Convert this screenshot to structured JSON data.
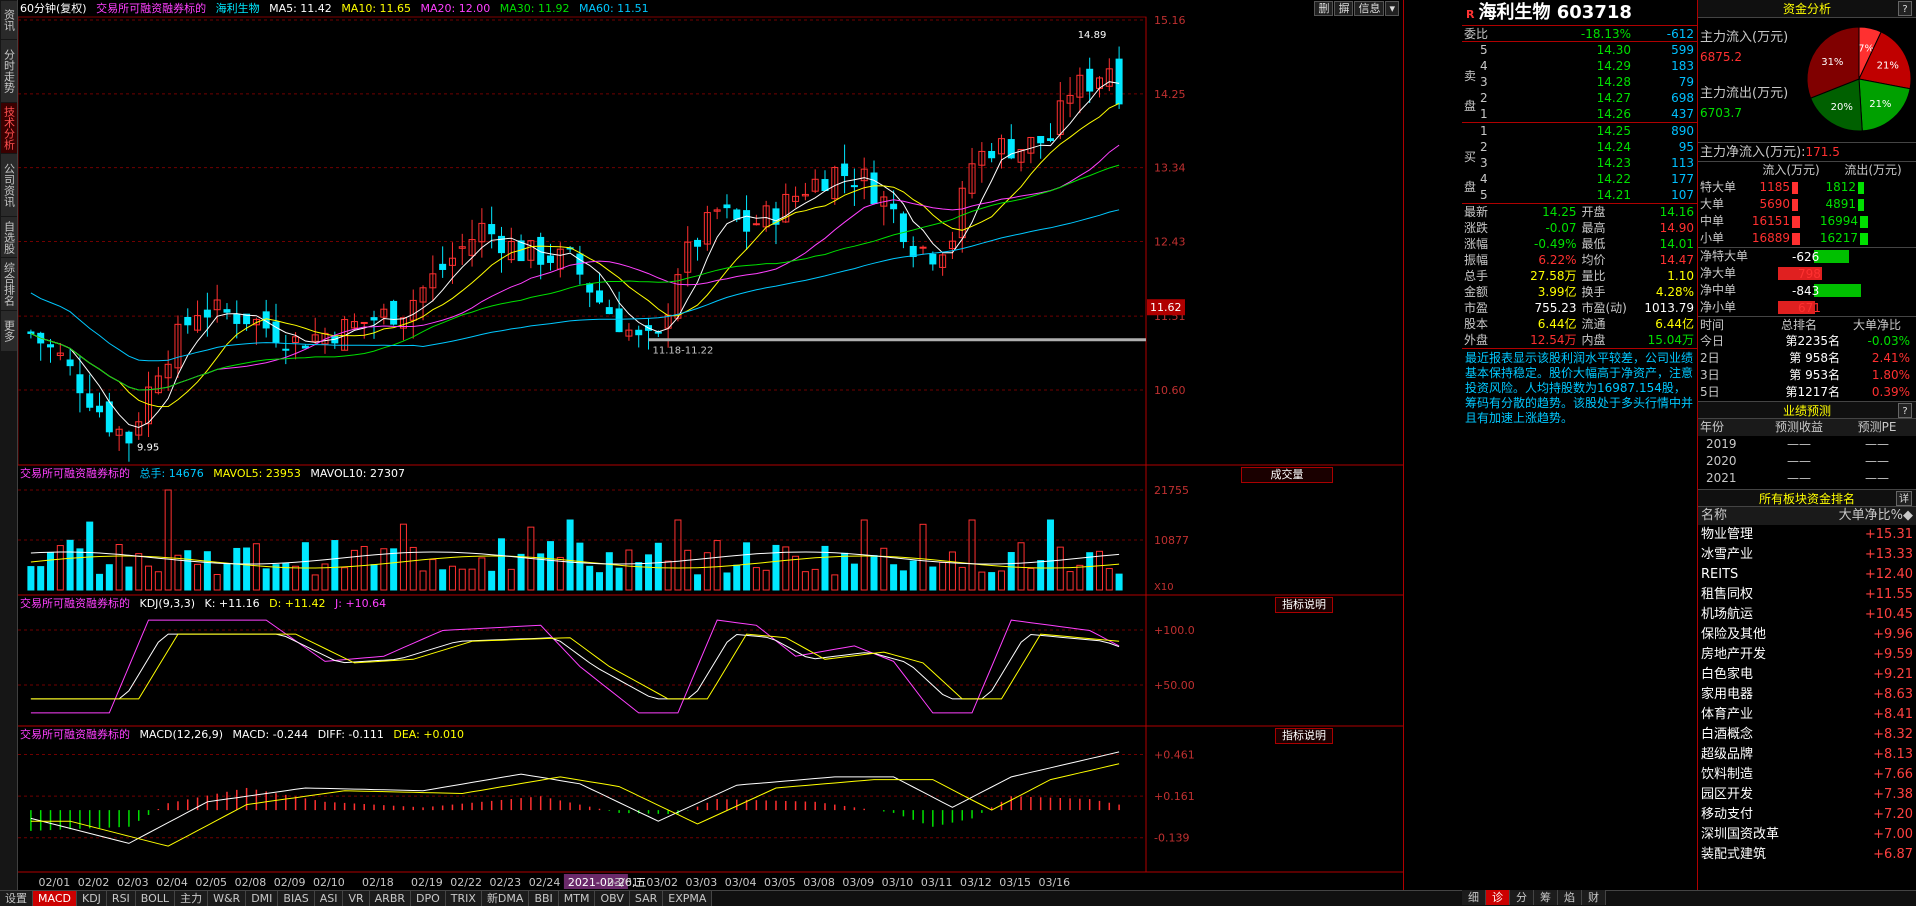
{
  "chart_header": {
    "period": "60分钟(复权)",
    "tag": "交易所可融资融券标的",
    "stock": "海利生物",
    "ma5": "MA5: 11.42",
    "ma10": "MA10: 11.65",
    "ma20": "MA20: 12.00",
    "ma30": "MA30: 11.92",
    "ma60": "MA60: 11.51"
  },
  "toolbar": {
    "b1": "删",
    "b2": "摒",
    "b3": "信息",
    "b4": "▾"
  },
  "price_axis": [
    "15.16",
    "14.25",
    "13.34",
    "12.43",
    "11.51",
    "10.60"
  ],
  "price_marker": "11.62",
  "annotations": {
    "high": "14.89",
    "low": "9.95",
    "range": "11.18-11.22"
  },
  "vol_header": {
    "tag": "交易所可融资融券标的",
    "total": "总手: 14676",
    "mavol5": "MAVOL5: 23953",
    "mavol10": "MAVOL10: 27307",
    "button": "成交量"
  },
  "vol_axis": [
    "21755",
    "10877"
  ],
  "vol_unit": "X10",
  "kdj_header": {
    "tag": "交易所可融资融券标的",
    "name": "KDJ(9,3,3)",
    "k": "K: +11.16",
    "d": "D: +11.42",
    "j": "J: +10.64",
    "button": "指标说明"
  },
  "kdj_axis": [
    "+100.0",
    "+50.00"
  ],
  "macd_header": {
    "tag": "交易所可融资融券标的",
    "name": "MACD(12,26,9)",
    "macd": "MACD: -0.244",
    "diff": "DIFF: -0.111",
    "dea": "DEA: +0.010",
    "button": "指标说明"
  },
  "macd_axis": [
    "+0.461",
    "+0.161",
    "-0.139"
  ],
  "date_axis": [
    "02/01",
    "02/02",
    "02/03",
    "02/04",
    "02/05",
    "02/08",
    "02/09",
    "02/10",
    "02/18",
    "02/19",
    "02/22",
    "02/23",
    "02/24",
    "2021-02-26,五",
    "03/01",
    "03/02",
    "03/03",
    "03/04",
    "03/05",
    "03/08",
    "03/09",
    "03/10",
    "03/11",
    "03/12",
    "03/15",
    "03/16"
  ],
  "left_tabs": [
    "资讯",
    "分时走势",
    "技术分析",
    "公司资讯",
    "自选股",
    "综合排名",
    "更多"
  ],
  "bottom_tabs": [
    "设置",
    "MACD",
    "KDJ",
    "RSI",
    "BOLL",
    "主力",
    "W&R",
    "DMI",
    "BIAS",
    "ASI",
    "VR",
    "ARBR",
    "DPO",
    "TRIX",
    "新DMA",
    "BBI",
    "MTM",
    "OBV",
    "SAR",
    "EXPMA"
  ],
  "quote": {
    "r": "R",
    "title": "海利生物 603718",
    "weibi_label": "委比",
    "weibi": "-18.13%",
    "weicha": "-612",
    "sell_label": "卖",
    "sell_label2": "盘",
    "sells": [
      {
        "l": "5",
        "p": "14.30",
        "v": "599"
      },
      {
        "l": "4",
        "p": "14.29",
        "v": "183"
      },
      {
        "l": "3",
        "p": "14.28",
        "v": "79"
      },
      {
        "l": "2",
        "p": "14.27",
        "v": "698"
      },
      {
        "l": "1",
        "p": "14.26",
        "v": "437"
      }
    ],
    "buy_label": "买",
    "buy_label2": "盘",
    "buys": [
      {
        "l": "1",
        "p": "14.25",
        "v": "890"
      },
      {
        "l": "2",
        "p": "14.24",
        "v": "95"
      },
      {
        "l": "3",
        "p": "14.23",
        "v": "113"
      },
      {
        "l": "4",
        "p": "14.22",
        "v": "177"
      },
      {
        "l": "5",
        "p": "14.21",
        "v": "107"
      }
    ],
    "stats": [
      [
        "最新",
        "14.25",
        "开盘",
        "14.16"
      ],
      [
        "涨跌",
        "-0.07",
        "最高",
        "14.90"
      ],
      [
        "涨幅",
        "-0.49%",
        "最低",
        "14.01"
      ],
      [
        "振幅",
        "6.22%",
        "均价",
        "14.47"
      ],
      [
        "总手",
        "27.58万",
        "量比",
        "1.10"
      ],
      [
        "金额",
        "3.99亿",
        "换手",
        "4.28%"
      ],
      [
        "市盈",
        "755.23",
        "市盈(动)",
        "1013.79"
      ],
      [
        "股本",
        "6.44亿",
        "流通",
        "6.44亿"
      ],
      [
        "外盘",
        "12.54万",
        "内盘",
        "15.04万"
      ]
    ],
    "news": "最近报表显示该股利润水平较差，公司业绩基本保持稳定。股价大幅高于净资产，注意投资风险。人均持股数为16987.154股，筹码有分散的趋势。该股处于多头行情中并且有加速上涨趋势。"
  },
  "funds": {
    "title": "资金分析",
    "q": "?",
    "pie": [
      {
        "label": "7%",
        "v": 7,
        "color": "#ff3030"
      },
      {
        "label": "21%",
        "v": 21,
        "color": "#c00000"
      },
      {
        "label": "21%",
        "v": 21,
        "color": "#00a000"
      },
      {
        "label": "20%",
        "v": 20,
        "color": "#006000"
      },
      {
        "label": "31%",
        "v": 31,
        "color": "#800000"
      }
    ],
    "inflow_label": "主力流入(万元)",
    "inflow": "6875.2",
    "outflow_label": "主力流出(万元)",
    "outflow": "6703.7",
    "net_label": "主力净流入(万元):",
    "net": "171.5",
    "flow_head": [
      "流入(万元)",
      "流出(万元)"
    ],
    "flows": [
      {
        "n": "特大单",
        "in": "1185",
        "out": "1812"
      },
      {
        "n": "大单",
        "in": "5690",
        "out": "4891"
      },
      {
        "n": "中单",
        "in": "16151",
        "out": "16994"
      },
      {
        "n": "小单",
        "in": "16889",
        "out": "16217"
      }
    ],
    "nets": [
      {
        "n": "净特大单",
        "v": "-626",
        "dir": "g"
      },
      {
        "n": "净大单",
        "v": "798",
        "dir": "r"
      },
      {
        "n": "净中单",
        "v": "-843",
        "dir": "g"
      },
      {
        "n": "净小单",
        "v": "671",
        "dir": "r"
      }
    ],
    "rank_head": [
      "时间",
      "总排名",
      "大单净比"
    ],
    "ranks": [
      {
        "t": "今日",
        "r": "第2235名",
        "p": "-0.03%"
      },
      {
        "t": "2日",
        "r": "第 958名",
        "p": "2.41%"
      },
      {
        "t": "3日",
        "r": "第 953名",
        "p": "1.80%"
      },
      {
        "t": "5日",
        "r": "第1217名",
        "p": "0.39%"
      }
    ],
    "forecast_title": "业绩预测",
    "forecast_head": [
      "年份",
      "预测收益",
      "预测PE"
    ],
    "forecast": [
      {
        "y": "2019",
        "a": "——",
        "b": "——"
      },
      {
        "y": "2020",
        "a": "——",
        "b": "——"
      },
      {
        "y": "2021",
        "a": "——",
        "b": "——"
      }
    ],
    "sector_title": "所有板块资金排名",
    "sector_btn": "详",
    "sector_head": [
      "名称",
      "大单净比%◆"
    ],
    "sectors": [
      [
        "物业管理",
        "+15.31"
      ],
      [
        "冰雪产业",
        "+13.33"
      ],
      [
        "REITS",
        "+12.40"
      ],
      [
        "租售同权",
        "+11.55"
      ],
      [
        "机场航运",
        "+10.45"
      ],
      [
        "保险及其他",
        "+9.96"
      ],
      [
        "房地产开发",
        "+9.59"
      ],
      [
        "白色家电",
        "+9.21"
      ],
      [
        "家用电器",
        "+8.63"
      ],
      [
        "体育产业",
        "+8.41"
      ],
      [
        "白酒概念",
        "+8.32"
      ],
      [
        "超级品牌",
        "+8.13"
      ],
      [
        "饮料制造",
        "+7.66"
      ],
      [
        "园区开发",
        "+7.38"
      ],
      [
        "移动支付",
        "+7.20"
      ],
      [
        "深圳国资改革",
        "+7.00"
      ],
      [
        "装配式建筑",
        "+6.87"
      ]
    ],
    "bottom": [
      "细",
      "诊",
      "分",
      "筹",
      "焰",
      "财"
    ]
  },
  "colors": {
    "up": "#ff3030",
    "down": "#00e8ff",
    "ma5": "#ffffff",
    "ma10": "#ffff00",
    "ma20": "#ff40ff",
    "ma30": "#00e000",
    "ma60": "#00c8ff"
  }
}
